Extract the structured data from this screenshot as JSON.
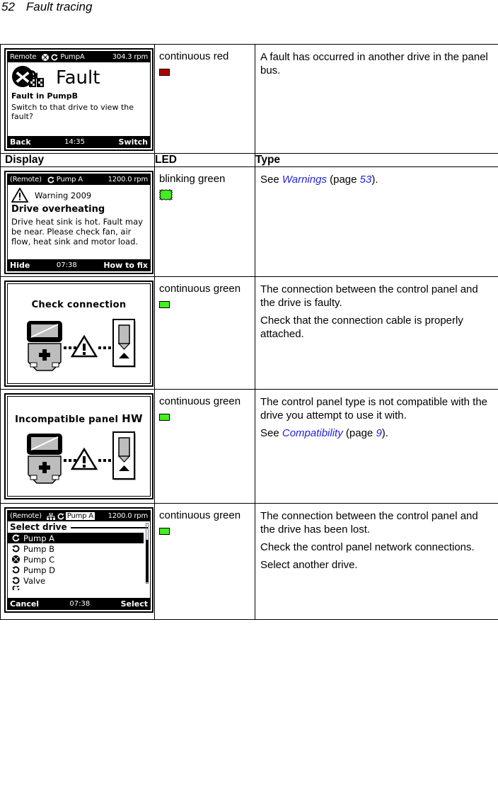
{
  "page": {
    "number": "52",
    "title": "Fault tracing"
  },
  "colors": {
    "led_red": "#b00000",
    "led_green": "#44ee22",
    "xref_blue": "#2222dd"
  },
  "table": {
    "headers": {
      "display": "Display",
      "led": "LED",
      "type": "Type"
    },
    "rows": [
      {
        "led_label": "continuous red",
        "led_icon": "led-square-red",
        "type_lines": [
          {
            "text": "A fault has occurred in another drive in the panel bus."
          }
        ],
        "display_kind": "fault-screen"
      },
      {
        "led_label": "blinking green",
        "led_icon": "led-starburst-green",
        "type_lines": [
          {
            "prefix": "See ",
            "link": "Warnings",
            "mid": " (page ",
            "pagenum": "53",
            "suffix": ")."
          }
        ],
        "display_kind": "warning-screen"
      },
      {
        "led_label": "continuous green",
        "led_icon": "led-square-green",
        "type_lines": [
          {
            "text": "The connection between the control panel and the drive is faulty."
          },
          {
            "text": "Check that the connection cable is properly attached."
          }
        ],
        "display_kind": "check-connection-screen"
      },
      {
        "led_label": "continuous green",
        "led_icon": "led-square-green",
        "type_lines": [
          {
            "text": "The control panel type is not compatible with the drive you attempt to use it with."
          },
          {
            "prefix": "See ",
            "link": "Compatibility",
            "mid": " (page ",
            "pagenum": "9",
            "suffix": ")."
          }
        ],
        "display_kind": "incompatible-screen"
      },
      {
        "led_label": "continuous green",
        "led_icon": "led-square-green",
        "type_lines": [
          {
            "text": "The connection between the control panel and the drive has been lost."
          },
          {
            "text": "Check the control panel network connections."
          },
          {
            "text": "Select another drive."
          }
        ],
        "display_kind": "select-drive-screen"
      }
    ]
  },
  "screens": {
    "fault": {
      "status_left": "Remote",
      "status_drive": "PumpA",
      "status_right": "304.3 rpm",
      "heading": "Fault",
      "sub": "Fault in PumpB",
      "question": "Switch to that drive to view the fault?",
      "soft_left": "Back",
      "clock": "14:35",
      "soft_right": "Switch"
    },
    "warning": {
      "status_left": "(Remote)",
      "status_drive": "Pump A",
      "status_right": "1200.0 rpm",
      "code": "Warning 2009",
      "title": "Drive overheating",
      "body": "Drive heat sink is hot. Fault may be near. Please check fan, air flow, heat sink and motor load.",
      "soft_left": "Hide",
      "clock": "07:38",
      "soft_right": "How to fix"
    },
    "check_connection": {
      "title": "Check connection"
    },
    "incompatible": {
      "title_main": "Incompatible panel ",
      "title_hw": "HW"
    },
    "select_drive": {
      "status_left": "(Remote)",
      "status_drive": "Pump A",
      "status_right": "1200.0 rpm",
      "list_title": "Select drive",
      "items": [
        {
          "label": "Pump A",
          "icon": "rotate-forward-icon",
          "selected": true
        },
        {
          "label": "Pump B",
          "icon": "rotate-back-icon",
          "selected": false
        },
        {
          "label": "Pump C",
          "icon": "fault-x-icon",
          "selected": false
        },
        {
          "label": "Pump D",
          "icon": "rotate-back-icon",
          "selected": false
        },
        {
          "label": "Valve",
          "icon": "rotate-back-icon",
          "selected": false
        }
      ],
      "soft_left": "Cancel",
      "clock": "07:38",
      "soft_right": "Select"
    }
  }
}
